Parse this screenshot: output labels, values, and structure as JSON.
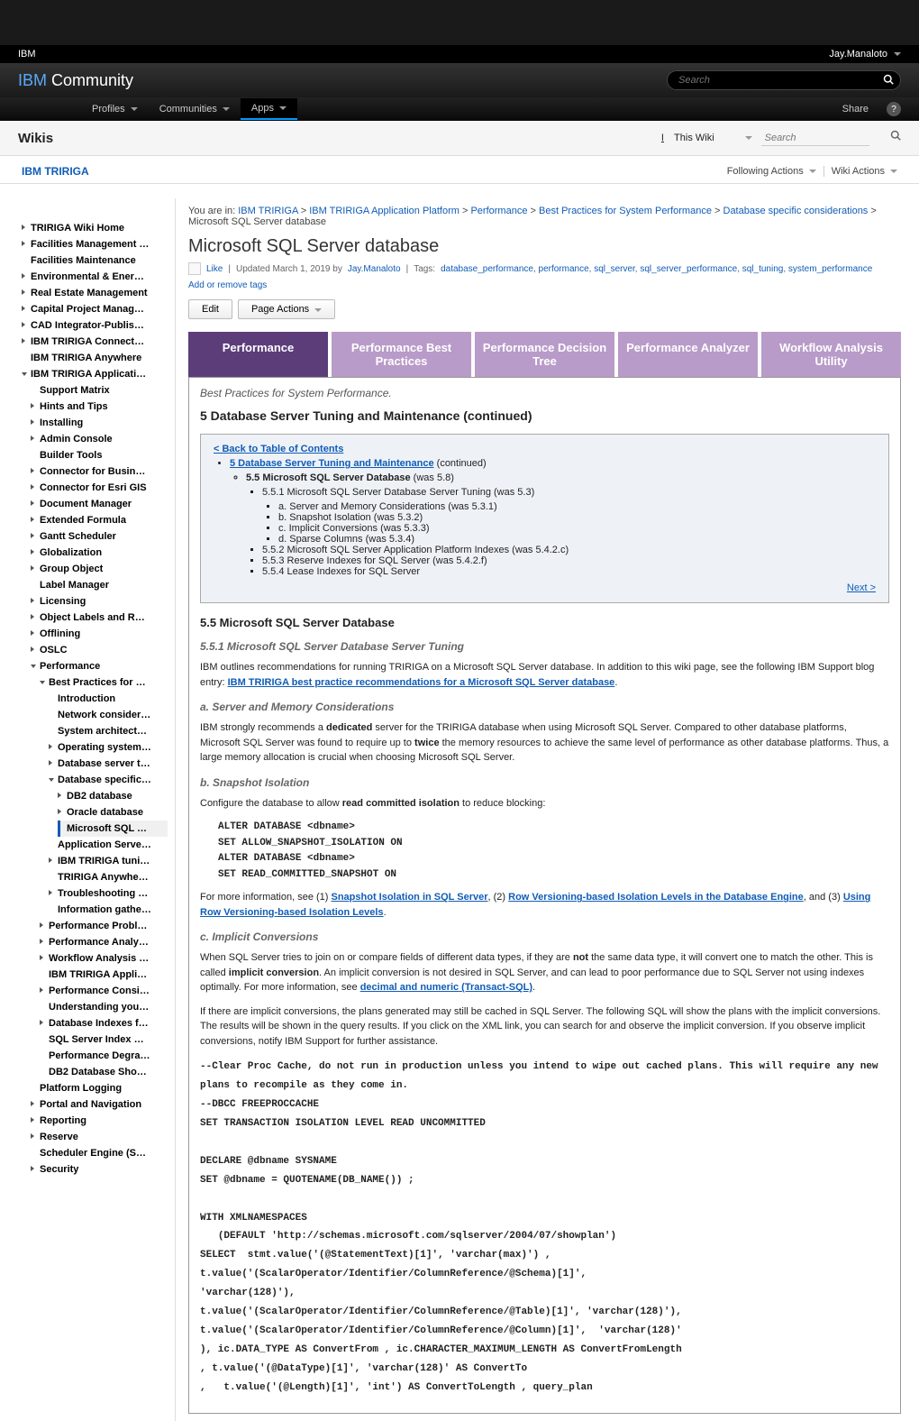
{
  "top": {
    "ibm": "IBM",
    "user": "Jay.Manaloto"
  },
  "community": {
    "title_pre": "IBM",
    "title_post": " Community",
    "search_placeholder": "Search"
  },
  "nav": {
    "profiles": "Profiles",
    "communities": "Communities",
    "apps": "Apps",
    "share": "Share",
    "help": "?"
  },
  "wikis": {
    "title": "Wikis",
    "scope": "This Wiki",
    "search_placeholder": "Search"
  },
  "tririga": {
    "link": "IBM TRIRIGA",
    "following": "Following Actions",
    "wiki_actions": "Wiki Actions"
  },
  "sidebar": {
    "items": [
      "TRIRIGA Wiki Home",
      "Facilities Management …",
      "Facilities Maintenance",
      "Environmental & Ener…",
      "Real Estate Management",
      "Capital Project Manag…",
      "CAD Integrator-Publis…",
      "IBM TRIRIGA Connect…",
      "IBM TRIRIGA Anywhere",
      "IBM TRIRIGA Applicati…"
    ],
    "app_sub": [
      "Support Matrix",
      "Hints and Tips",
      "Installing",
      "Admin Console",
      "Builder Tools",
      "Connector for Busin…",
      "Connector for Esri GIS",
      "Document Manager",
      "Extended Formula",
      "Gantt Scheduler",
      "Globalization",
      "Group Object",
      "Label Manager",
      "Licensing",
      "Object Labels and R…",
      "Offlining",
      "OSLC",
      "Performance"
    ],
    "perf_sub": [
      "Best Practices for …"
    ],
    "bp_sub": [
      "Introduction",
      "Network consider…",
      "System architect…",
      "Operating system…",
      "Database server t…",
      "Database specific…"
    ],
    "db_sub": [
      "DB2 database",
      "Oracle database",
      "Microsoft SQL …"
    ],
    "after_db": [
      "Application Serve…",
      "IBM TRIRIGA tuni…",
      "TRIRIGA Anywhe…",
      "Troubleshooting …",
      "Information gathe…"
    ],
    "after_bp": [
      "Performance Probl…",
      "Performance Analy…",
      "Workflow Analysis …",
      "IBM TRIRIGA Appli…",
      "Performance Consi…",
      "Understanding you…",
      "Database Indexes f…",
      "SQL Server Index …",
      "Performance Degra…",
      "DB2 Database Sho…"
    ],
    "after_perf": [
      "Platform Logging",
      "Portal and Navigation",
      "Reporting",
      "Reserve",
      "Scheduler Engine (S…",
      "Security"
    ]
  },
  "breadcrumb": {
    "prefix": "You are in: ",
    "links": [
      "IBM TRIRIGA",
      "IBM TRIRIGA Application Platform",
      "Performance",
      "Best Practices for System Performance",
      "Database specific considerations"
    ],
    "tail": "Microsoft SQL Server database"
  },
  "page": {
    "title": "Microsoft SQL Server database",
    "like": "Like",
    "updated": "Updated March 1, 2019 by",
    "author": "Jay.Manaloto",
    "tags_label": "Tags:",
    "tags": [
      "database_performance",
      "performance",
      "sql_server",
      "sql_server_performance",
      "sql_tuning",
      "system_performance"
    ],
    "add_remove": "Add or remove tags",
    "edit": "Edit",
    "page_actions": "Page Actions"
  },
  "tabs": [
    "Performance",
    "Performance Best Practices",
    "Performance Decision Tree",
    "Performance Analyzer",
    "Workflow Analysis Utility"
  ],
  "body": {
    "breadcrumb_note": "Best Practices for System Performance.",
    "head1": "5 Database Server Tuning and Maintenance (continued)",
    "toc_back": "< Back to Table of Contents",
    "toc_l1": "5 Database Server Tuning and Maintenance",
    "toc_l1_suffix": " (continued)",
    "toc_l2": "5.5 Microsoft SQL Server Database",
    "toc_l2_suffix": " (was 5.8)",
    "toc_items": [
      "5.5.1 Microsoft SQL Server Database Server Tuning (was 5.3)",
      "a. Server and Memory Considerations (was 5.3.1)",
      "b. Snapshot Isolation (was 5.3.2)",
      "c. Implicit Conversions (was 5.3.3)",
      "d. Sparse Columns (was 5.3.4)",
      "5.5.2 Microsoft SQL Server Application Platform Indexes (was 5.4.2.c)",
      "5.5.3 Reserve Indexes for SQL Server (was 5.4.2.f)",
      "5.5.4 Lease Indexes for SQL Server"
    ],
    "next": "Next >",
    "sec55": "5.5 Microsoft SQL Server Database",
    "sec551": "5.5.1 Microsoft SQL Server Database Server Tuning",
    "p551": "IBM outlines recommendations for running TRIRIGA on a Microsoft SQL Server database. In addition to this wiki page, see the following IBM Support blog entry: ",
    "p551_link": "IBM TRIRIGA best practice recommendations for a Microsoft SQL Server database",
    "sec_a": "a. Server and Memory Considerations",
    "p_a1": "IBM strongly recommends a ",
    "p_a2": "dedicated",
    "p_a3": " server for the TRIRIGA database when using Microsoft SQL Server. Compared to other database platforms, Microsoft SQL Server was found to require up to ",
    "p_a4": "twice",
    "p_a5": " the memory resources to achieve the same level of performance as other database platforms. Thus, a large memory allocation is crucial when choosing Microsoft SQL Server.",
    "sec_b": "b. Snapshot Isolation",
    "p_b1": "Configure the database to allow ",
    "p_b2": "read committed isolation",
    "p_b3": " to reduce blocking:",
    "code_b": "ALTER DATABASE <dbname>\nSET ALLOW_SNAPSHOT_ISOLATION ON\nALTER DATABASE <dbname>\nSET READ_COMMITTED_SNAPSHOT ON",
    "p_b_more1": "For more information, see (1) ",
    "p_b_link1": "Snapshot Isolation in SQL Server",
    "p_b_more2": ", (2) ",
    "p_b_link2": "Row Versioning-based Isolation Levels in the Database Engine",
    "p_b_more3": ", and (3) ",
    "p_b_link3": "Using Row Versioning-based Isolation Levels",
    "sec_c": "c. Implicit Conversions",
    "p_c1a": "When SQL Server tries to join on or compare fields of different data types, if they are ",
    "p_c1b": "not",
    "p_c1c": " the same data type, it will convert one to match the other. This is called ",
    "p_c1d": "implicit conversion",
    "p_c1e": ". An implicit conversion is not desired in SQL Server, and can lead to poor performance due to SQL Server not using indexes optimally. For more information, see ",
    "p_c1_link": "decimal and numeric (Transact-SQL)",
    "p_c2": "If there are implicit conversions, the plans generated may still be cached in SQL Server. The following SQL will show the plans with the implicit conversions. The results will be shown in the query results. If you click on the XML link, you can search for and observe the implicit conversion. If you observe implicit conversions, notify IBM Support for further assistance.",
    "code_c": "--Clear Proc Cache, do not run in production unless you intend to wipe out cached plans. This will require any new plans to recompile as they come in.\n--DBCC FREEPROCCACHE\nSET TRANSACTION ISOLATION LEVEL READ UNCOMMITTED\n\nDECLARE @dbname SYSNAME\nSET @dbname = QUOTENAME(DB_NAME()) ;\n\nWITH XMLNAMESPACES\n   (DEFAULT 'http://schemas.microsoft.com/sqlserver/2004/07/showplan')\nSELECT  stmt.value('(@StatementText)[1]', 'varchar(max)') ,\nt.value('(ScalarOperator/Identifier/ColumnReference/@Schema)[1]',\n'varchar(128)'),\nt.value('(ScalarOperator/Identifier/ColumnReference/@Table)[1]', 'varchar(128)'),\nt.value('(ScalarOperator/Identifier/ColumnReference/@Column)[1]',  'varchar(128)'\n), ic.DATA_TYPE AS ConvertFrom , ic.CHARACTER_MAXIMUM_LENGTH AS ConvertFromLength\n, t.value('(@DataType)[1]', 'varchar(128)' AS ConvertTo\n,   t.value('(@Length)[1]', 'int') AS ConvertToLength , query_plan"
  }
}
